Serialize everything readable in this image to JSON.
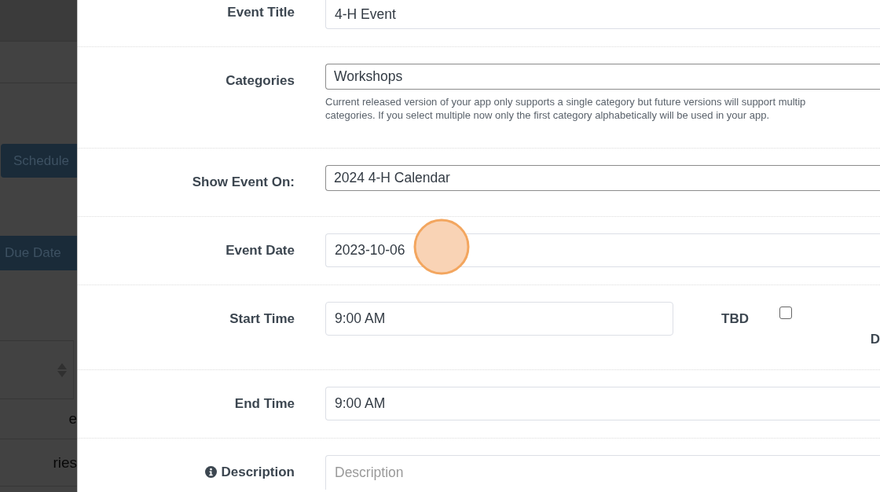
{
  "background_panel": {
    "buttons": [
      {
        "label": "Schedule"
      },
      {
        "label": "Due Date"
      }
    ],
    "table": {
      "rows": [
        "e",
        "ries"
      ]
    }
  },
  "form": {
    "fields": [
      {
        "kind": "text",
        "label": "Event Title",
        "info": false,
        "value": "4-H Event",
        "clicked": false
      },
      {
        "kind": "select",
        "label": "Categories",
        "info": false,
        "value": "Workshops",
        "help": "Current released version of your app only supports a single category but future versions will support multip\ncategories. If you select multiple now only the first category alphabetically will be used in your app.",
        "clicked": false
      },
      {
        "kind": "select",
        "label": "Show Event On:",
        "info": false,
        "value": "2024 4-H Calendar",
        "clicked": false
      },
      {
        "kind": "text",
        "label": "Event Date",
        "info": false,
        "value": "2023-10-06",
        "clicked": true
      },
      {
        "kind": "time_tbd",
        "label": "Start Time",
        "info": false,
        "value": "9:00 AM",
        "tbd_label": "TBD",
        "tbd_checked": false,
        "cut_label": "D",
        "clicked": false
      },
      {
        "kind": "text",
        "label": "End Time",
        "info": false,
        "value": "9:00 AM",
        "clicked": false
      },
      {
        "kind": "textarea",
        "label": "Description",
        "info": true,
        "placeholder": "Description",
        "clicked": false
      }
    ]
  }
}
